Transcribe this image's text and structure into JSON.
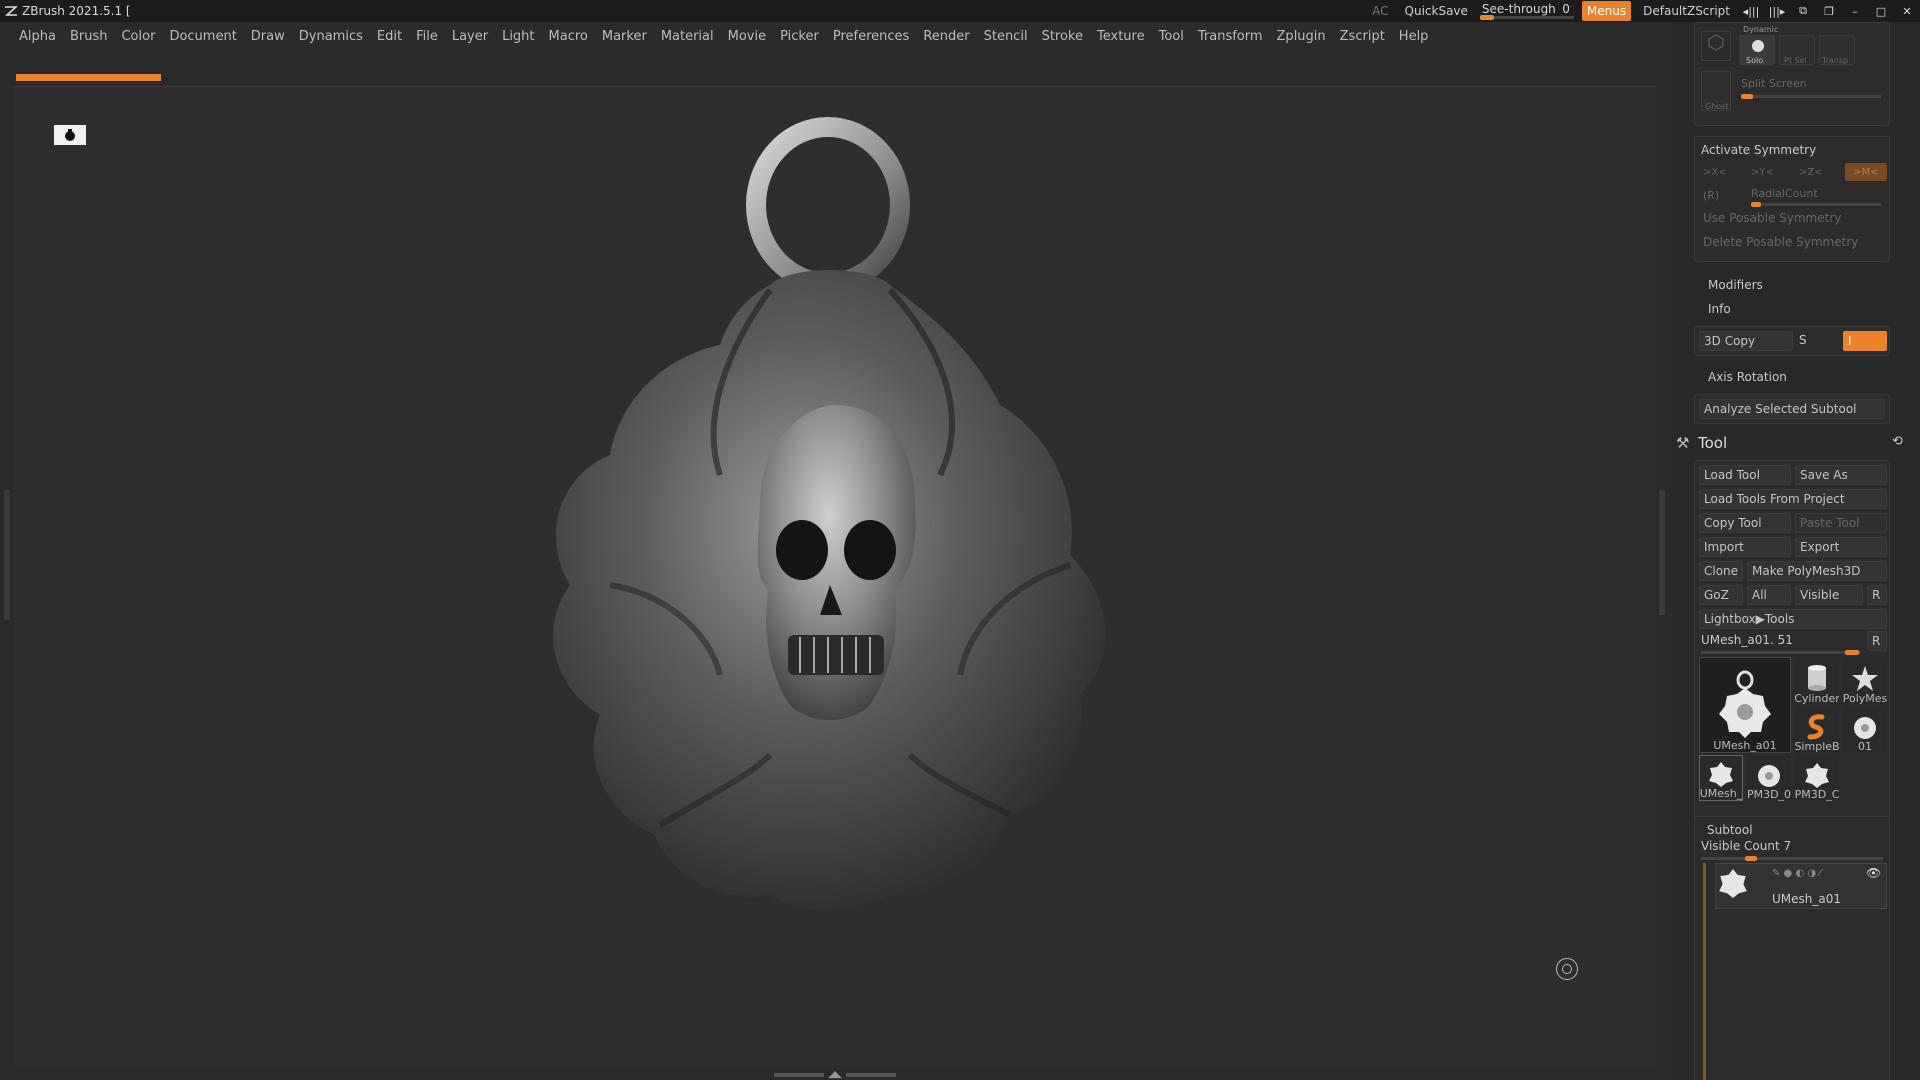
{
  "app": {
    "title": "ZBrush 2021.5.1 [",
    "ac_label": "AC",
    "quicksave_label": "QuickSave",
    "seethrough_label": "See-through",
    "seethrough_value": "0",
    "menus_label": "Menus",
    "script_label": "DefaultZScript"
  },
  "menu": [
    "Alpha",
    "Brush",
    "Color",
    "Document",
    "Draw",
    "Dynamics",
    "Edit",
    "File",
    "Layer",
    "Light",
    "Macro",
    "Marker",
    "Material",
    "Movie",
    "Picker",
    "Preferences",
    "Render",
    "Stencil",
    "Stroke",
    "Texture",
    "Tool",
    "Transform",
    "Zplugin",
    "Zscript",
    "Help"
  ],
  "panel": {
    "dynamic_label": "Dynamic",
    "solo_label": "Solo",
    "ptsel_label": "Pt Sel",
    "transp_label": "Transp",
    "ghost_label": "Ghost",
    "split_screen_label": "Split Screen",
    "activate_symmetry_label": "Activate Symmetry",
    "sym_x": ">X<",
    "sym_y": ">Y<",
    "sym_z": ">Z<",
    "sym_m": ">M<",
    "sym_r": "(R)",
    "radialcount_label": "RadialCount",
    "use_posable_label": "Use Posable Symmetry",
    "delete_posable_label": "Delete Posable Symmetry",
    "modifiers_label": "Modifiers",
    "info_label": "Info",
    "copy3d_label": "3D Copy",
    "copy3d_s": "S",
    "copy3d_value": "I",
    "axis_rotation_label": "Axis Rotation",
    "analyze_label": "Analyze Selected Subtool",
    "tool_header": "Tool",
    "load_tool": "Load Tool",
    "save_as": "Save As",
    "load_from_project": "Load Tools From Project",
    "copy_tool": "Copy Tool",
    "paste_tool": "Paste Tool",
    "import": "Import",
    "export": "Export",
    "clone": "Clone",
    "make_polymesh": "Make PolyMesh3D",
    "goz": "GoZ",
    "all": "All",
    "visible": "Visible",
    "r_label": "R",
    "lightbox_tools": "Lightbox▶Tools",
    "current_tool": "UMesh_a01. 51",
    "current_tool_r": "R",
    "tool_thumbs": [
      {
        "label": "UMesh_a01",
        "icon": "medallion-icon"
      },
      {
        "label": "Cylinder",
        "icon": "cylinder-icon"
      },
      {
        "label": "PolyMes",
        "icon": "star-icon"
      },
      {
        "label": "SimpleB",
        "icon": "simplebrush-icon"
      },
      {
        "label": "01",
        "icon": "medallion-small-icon"
      },
      {
        "label": "UMesh_",
        "icon": "medallion-small-icon"
      },
      {
        "label": "PM3D_0",
        "icon": "medallion-small-icon"
      },
      {
        "label": "PM3D_C",
        "icon": "medallion-small-icon"
      }
    ],
    "subtool_label": "Subtool",
    "visible_count_label": "Visible Count 7",
    "subtool_item_name": "UMesh_a01"
  },
  "colors": {
    "accent": "#e9822a",
    "background": "#2e2e2e",
    "panel": "#282828"
  }
}
